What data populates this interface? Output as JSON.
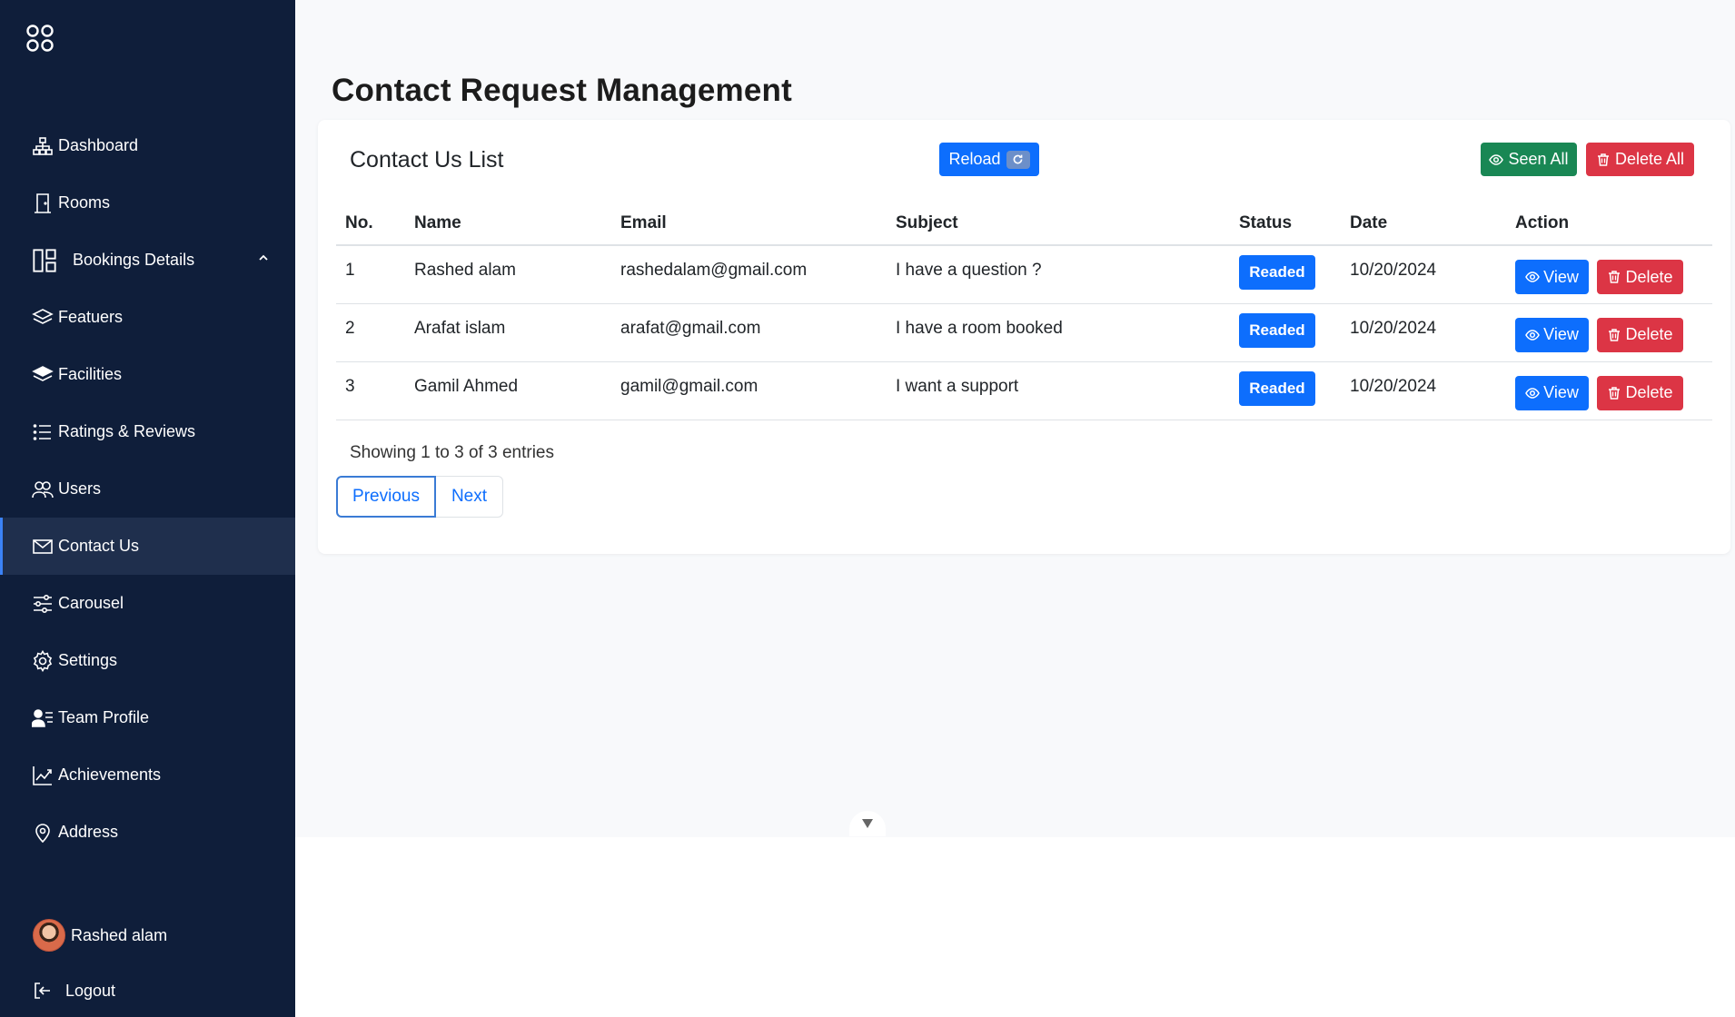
{
  "sidebar": {
    "logo_icon": "apps-circles-icon",
    "items": [
      {
        "label": "Dashboard",
        "icon": "sitemap-icon"
      },
      {
        "label": "Rooms",
        "icon": "door-icon"
      },
      {
        "label": "Bookings Details",
        "icon": "layout-icon"
      },
      {
        "label": "Featuers",
        "icon": "layers-icon"
      },
      {
        "label": "Facilities",
        "icon": "stack-icon"
      },
      {
        "label": "Ratings & Reviews",
        "icon": "list-icon"
      },
      {
        "label": "Users",
        "icon": "users-icon"
      },
      {
        "label": "Contact Us",
        "icon": "envelope-icon"
      },
      {
        "label": "Carousel",
        "icon": "sliders-icon"
      },
      {
        "label": "Settings",
        "icon": "gear-icon"
      },
      {
        "label": "Team Profile",
        "icon": "person-lines-icon"
      },
      {
        "label": "Achievements",
        "icon": "graph-up-icon"
      },
      {
        "label": "Address",
        "icon": "geo-pin-icon"
      }
    ],
    "active": "Contact Us",
    "user_name": "Rashed alam",
    "logout_label": "Logout"
  },
  "page": {
    "title": "Contact Request Management"
  },
  "card": {
    "title": "Contact Us List",
    "reload_label": "Reload",
    "seen_all_label": "Seen All",
    "delete_all_label": "Delete All"
  },
  "table": {
    "headers": [
      "No.",
      "Name",
      "Email",
      "Subject",
      "Status",
      "Date",
      "Action"
    ],
    "rows": [
      {
        "no": "1",
        "name": "Rashed alam",
        "email": "rashedalam@gmail.com",
        "subject": "I have a question ?",
        "status": "Readed",
        "date": "10/20/2024",
        "view": "View",
        "delete": "Delete"
      },
      {
        "no": "2",
        "name": "Arafat islam",
        "email": "arafat@gmail.com",
        "subject": "I have a room booked",
        "status": "Readed",
        "date": "10/20/2024",
        "view": "View",
        "delete": "Delete"
      },
      {
        "no": "3",
        "name": "Gamil Ahmed",
        "email": "gamil@gmail.com",
        "subject": "I want a support",
        "status": "Readed",
        "date": "10/20/2024",
        "view": "View",
        "delete": "Delete"
      }
    ]
  },
  "footer": {
    "entries_text": "Showing 1 to 3 of 3 entries",
    "previous_label": "Previous",
    "next_label": "Next"
  },
  "colors": {
    "sidebar_bg": "#0f1e3a",
    "primary": "#0d6efd",
    "success": "#198754",
    "danger": "#dc3545"
  }
}
